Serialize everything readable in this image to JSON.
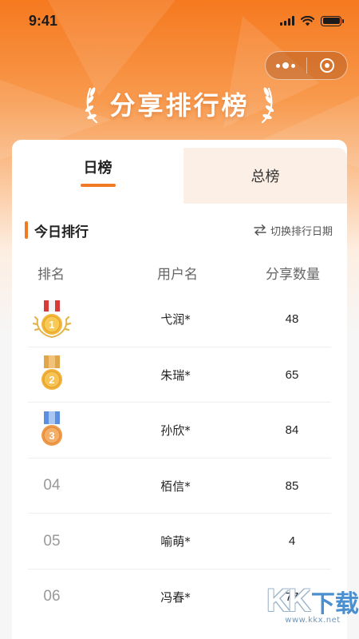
{
  "status_bar": {
    "time": "9:41",
    "icons": [
      "signal-icon",
      "wifi-icon",
      "battery-icon"
    ]
  },
  "capsule": {
    "icons": [
      "more-dots-icon",
      "close-target-icon"
    ]
  },
  "header": {
    "title": "分享排行榜",
    "decoration_icons": [
      "laurel-left-icon",
      "laurel-right-icon"
    ]
  },
  "tabs": [
    {
      "label": "日榜",
      "active": true
    },
    {
      "label": "总榜",
      "active": false
    }
  ],
  "section": {
    "title": "今日排行",
    "switch_label": "切换排行日期",
    "switch_icon": "swap-arrows-icon"
  },
  "table": {
    "columns": [
      "排名",
      "用户名",
      "分享数量"
    ],
    "rows": [
      {
        "rank": "1",
        "medal": "gold",
        "user": "弋润*",
        "count": "48"
      },
      {
        "rank": "2",
        "medal": "silver",
        "user": "朱瑞*",
        "count": "65"
      },
      {
        "rank": "3",
        "medal": "bronze",
        "user": "孙欣*",
        "count": "84"
      },
      {
        "rank": "04",
        "medal": null,
        "user": "栢信*",
        "count": "85"
      },
      {
        "rank": "05",
        "medal": null,
        "user": "喻萌*",
        "count": "4"
      },
      {
        "rank": "06",
        "medal": null,
        "user": "冯春*",
        "count": "77"
      }
    ]
  },
  "watermark": {
    "brand": "KK",
    "brand_cn": "下载",
    "url": "www.kkx.net"
  },
  "colors": {
    "accent": "#f07a24",
    "header_gradient_top": "#f5791f",
    "tab_inactive_bg": "#fcefe5",
    "gold_medal": "#f3b73a",
    "gold_ribbon": "#d83a3a",
    "silver_ribbon": "#e2a64a",
    "bronze_ribbon": "#5b8fe0"
  }
}
